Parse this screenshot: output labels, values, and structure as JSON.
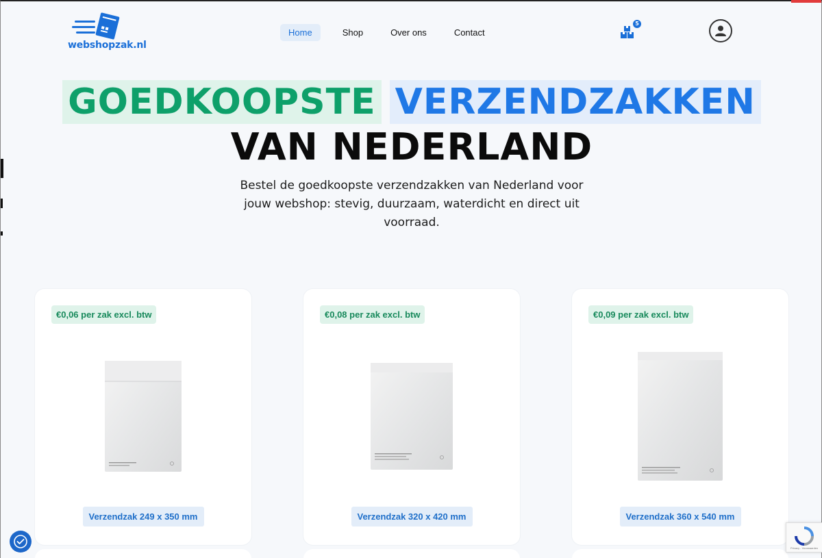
{
  "brand": {
    "name": "webshopzak.nl",
    "accent": "#1a6fd8",
    "green": "#0ea06a"
  },
  "nav": {
    "items": [
      {
        "label": "Home",
        "active": true
      },
      {
        "label": "Shop",
        "active": false
      },
      {
        "label": "Over ons",
        "active": false
      },
      {
        "label": "Contact",
        "active": false
      }
    ]
  },
  "cart": {
    "count": "5",
    "icon": "boxes-icon"
  },
  "account": {
    "icon": "user-icon"
  },
  "hero": {
    "word_green": "GOEDKOOPSTE",
    "word_blue": "VERZENDZAKKEN",
    "line2": "VAN NEDERLAND",
    "subtitle": "Bestel de goedkoopste verzendzakken van Nederland voor jouw webshop: stevig, duurzaam, waterdicht en direct uit voorraad."
  },
  "products": [
    {
      "price": "€0,06 per zak excl. btw",
      "title": "Verzendzak 249 x 350 mm"
    },
    {
      "price": "€0,08 per zak excl. btw",
      "title": "Verzendzak 320 x 420 mm"
    },
    {
      "price": "€0,09 per zak excl. btw",
      "title": "Verzendzak 360 x 540 mm"
    }
  ],
  "recaptcha": {
    "text": "Privacy - Voorwaarden"
  }
}
